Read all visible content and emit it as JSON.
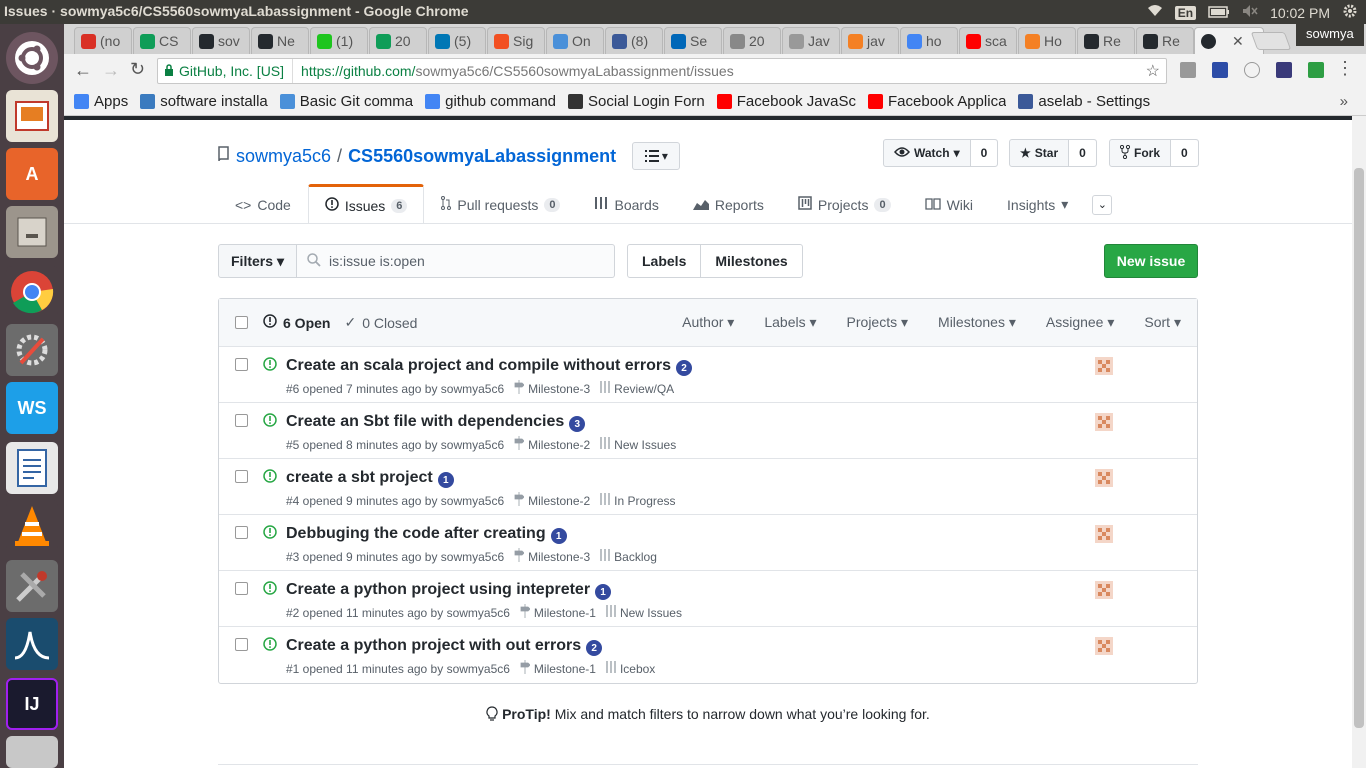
{
  "os": {
    "window_title": "Issues · sowmya5c6/CS5560sowmyaLabassignment - Google Chrome",
    "lang": "En",
    "clock": "10:02 PM",
    "user": "sowmya"
  },
  "tabs": [
    {
      "label": "(no",
      "color": "#d93025"
    },
    {
      "label": "CS",
      "color": "#0f9d58"
    },
    {
      "label": "sov",
      "color": "#24292e"
    },
    {
      "label": "Ne",
      "color": "#24292e"
    },
    {
      "label": "(1)",
      "color": "#1ec51e"
    },
    {
      "label": "20",
      "color": "#0f9d58"
    },
    {
      "label": "(5)",
      "color": "#0077b5"
    },
    {
      "label": "Sig",
      "color": "#f25022"
    },
    {
      "label": "On",
      "color": "#4a90d9"
    },
    {
      "label": "(8)",
      "color": "#3b5998"
    },
    {
      "label": "Se",
      "color": "#0067b8"
    },
    {
      "label": "20",
      "color": "#888888"
    },
    {
      "label": "Jav",
      "color": "#999999"
    },
    {
      "label": "jav",
      "color": "#f48024"
    },
    {
      "label": "ho",
      "color": "#4285f4"
    },
    {
      "label": "sca",
      "color": "#ff0000"
    },
    {
      "label": "Ho",
      "color": "#f48024"
    },
    {
      "label": "Re",
      "color": "#24292e"
    },
    {
      "label": "Re",
      "color": "#24292e"
    }
  ],
  "address": {
    "security_label": "GitHub, Inc. [US]",
    "url_host": "https://github.com/",
    "url_path": "sowmya5c6/CS5560sowmyaLabassignment/issues"
  },
  "bookmarks": [
    {
      "label": "Apps",
      "color": "#4285f4"
    },
    {
      "label": "software installa",
      "color": "#3b7bbf"
    },
    {
      "label": "Basic Git comma",
      "color": "#4a90d9"
    },
    {
      "label": "github command",
      "color": "#4285f4"
    },
    {
      "label": "Social Login Forn",
      "color": "#333333"
    },
    {
      "label": "Facebook JavaSc",
      "color": "#ff0000"
    },
    {
      "label": "Facebook Applica",
      "color": "#ff0000"
    },
    {
      "label": "aselab - Settings",
      "color": "#3b5998"
    }
  ],
  "repo": {
    "owner": "sowmya5c6",
    "separator": "/",
    "name": "CS5560sowmyaLabassignment",
    "watch_label": "Watch",
    "watch_count": "0",
    "star_label": "Star",
    "star_count": "0",
    "fork_label": "Fork",
    "fork_count": "0"
  },
  "nav": {
    "code": "Code",
    "issues": "Issues",
    "issues_count": "6",
    "pulls": "Pull requests",
    "pulls_count": "0",
    "boards": "Boards",
    "reports": "Reports",
    "projects": "Projects",
    "projects_count": "0",
    "wiki": "Wiki",
    "insights": "Insights"
  },
  "filters": {
    "filters_label": "Filters",
    "search_value": "is:issue is:open",
    "labels": "Labels",
    "milestones": "Milestones",
    "new_issue": "New issue"
  },
  "list_header": {
    "open": "6 Open",
    "closed": "0 Closed",
    "author": "Author",
    "labels": "Labels",
    "projects": "Projects",
    "milestones": "Milestones",
    "assignee": "Assignee",
    "sort": "Sort"
  },
  "issues": [
    {
      "title": "Create an scala project and compile without errors",
      "comments": "2",
      "meta": "#6 opened 7 minutes ago by sowmya5c6",
      "milestone": "Milestone-3",
      "column": "Review/QA"
    },
    {
      "title": "Create an Sbt file with dependencies",
      "comments": "3",
      "meta": "#5 opened 8 minutes ago by sowmya5c6",
      "milestone": "Milestone-2",
      "column": "New Issues"
    },
    {
      "title": "create a sbt project",
      "comments": "1",
      "meta": "#4 opened 9 minutes ago by sowmya5c6",
      "milestone": "Milestone-2",
      "column": "In Progress"
    },
    {
      "title": "Debbuging the code after creating",
      "comments": "1",
      "meta": "#3 opened 9 minutes ago by sowmya5c6",
      "milestone": "Milestone-3",
      "column": "Backlog"
    },
    {
      "title": "Create a python project using intepreter",
      "comments": "1",
      "meta": "#2 opened 11 minutes ago by sowmya5c6",
      "milestone": "Milestone-1",
      "column": "New Issues"
    },
    {
      "title": "Create a python project with out errors",
      "comments": "2",
      "meta": "#1 opened 11 minutes ago by sowmya5c6",
      "milestone": "Milestone-1",
      "column": "Icebox"
    }
  ],
  "protip": {
    "bold": "ProTip!",
    "text": " Mix and match filters to narrow down what you’re looking for."
  },
  "colors": {
    "accent_orange": "#e36209",
    "link_blue": "#0366d6",
    "green": "#28a745",
    "comment_bubble": "#344a9f"
  }
}
